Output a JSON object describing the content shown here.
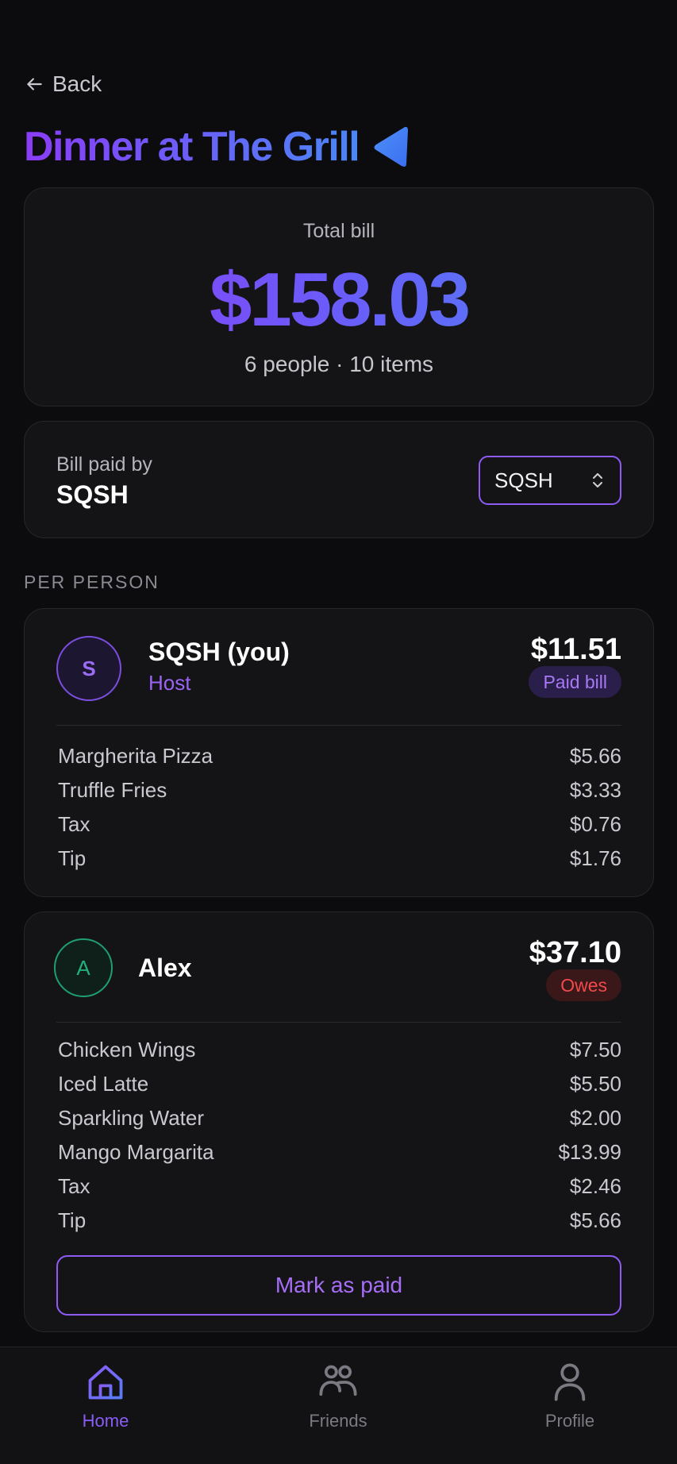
{
  "header": {
    "back_label": "Back",
    "title": "Dinner at The Grill"
  },
  "summary": {
    "total_label": "Total bill",
    "total_amount": "$158.03",
    "subtitle": "6 people · 10 items"
  },
  "payer": {
    "label": "Bill paid by",
    "name": "SQSH",
    "select_value": "SQSH"
  },
  "section_label": "PER PERSON",
  "people": [
    {
      "avatar_letter": "S",
      "name": "SQSH (you)",
      "role": "Host",
      "amount": "$11.51",
      "status": "Paid bill",
      "items": [
        {
          "label": "Margherita Pizza",
          "amount": "$5.66"
        },
        {
          "label": "Truffle Fries",
          "amount": "$3.33"
        },
        {
          "label": "Tax",
          "amount": "$0.76"
        },
        {
          "label": "Tip",
          "amount": "$1.76"
        }
      ]
    },
    {
      "avatar_letter": "A",
      "name": "Alex",
      "amount": "$37.10",
      "status": "Owes",
      "items": [
        {
          "label": "Chicken Wings",
          "amount": "$7.50"
        },
        {
          "label": "Iced Latte",
          "amount": "$5.50"
        },
        {
          "label": "Sparkling Water",
          "amount": "$2.00"
        },
        {
          "label": "Mango Margarita",
          "amount": "$13.99"
        },
        {
          "label": "Tax",
          "amount": "$2.46"
        },
        {
          "label": "Tip",
          "amount": "$5.66"
        }
      ],
      "action_label": "Mark as paid"
    }
  ],
  "tabbar": {
    "tabs": [
      {
        "label": "Home",
        "icon": "home-icon",
        "active": true
      },
      {
        "label": "Friends",
        "icon": "friends-icon",
        "active": false
      },
      {
        "label": "Profile",
        "icon": "profile-icon",
        "active": false
      }
    ]
  },
  "colors": {
    "accent": "#8b5cf6",
    "accent_blue": "#4d86f7",
    "owes": "#ef4b4b",
    "avatar_green": "#22b07d",
    "background": "#0c0c0e",
    "card": "#141416"
  }
}
